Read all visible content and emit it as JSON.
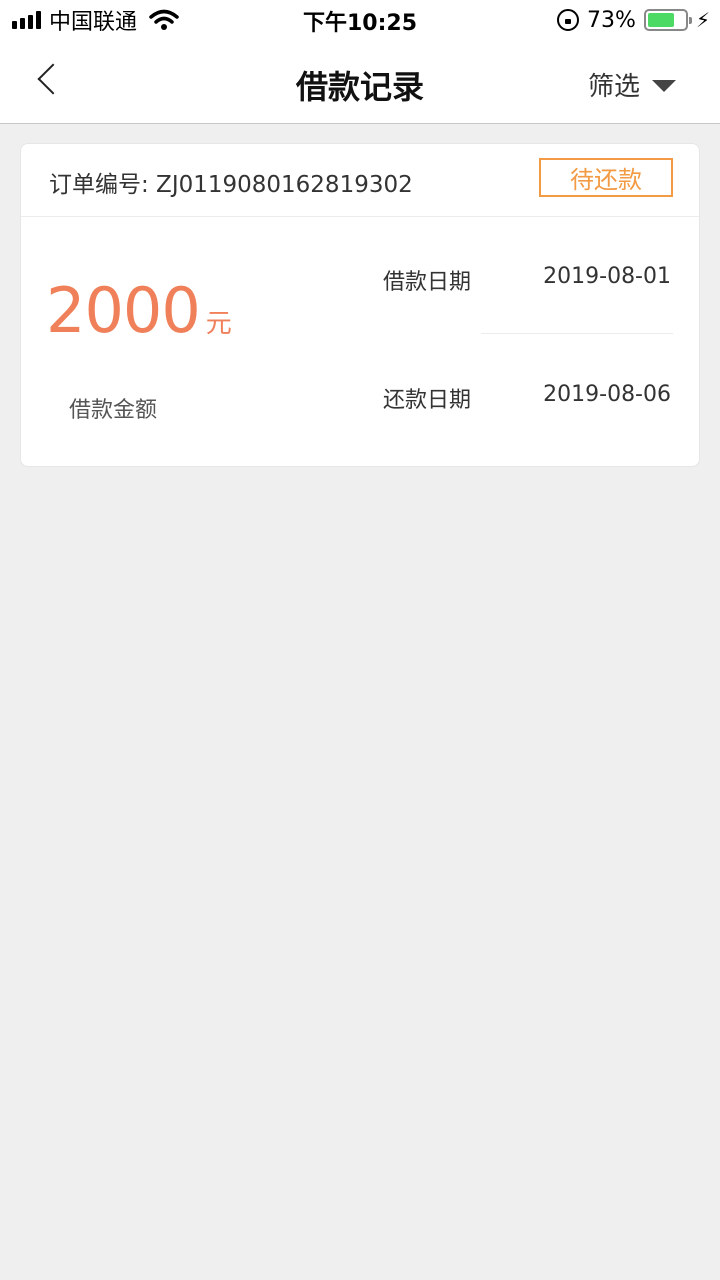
{
  "status_bar": {
    "carrier": "中国联通",
    "time": "下午10:25",
    "battery_percent": "73%",
    "battery_level": 0.73
  },
  "nav": {
    "title": "借款记录",
    "filter_label": "筛选"
  },
  "record": {
    "order_label": "订单编号: ZJ0119080162819302",
    "status": "待还款",
    "amount": "2000",
    "amount_unit": "元",
    "amount_label": "借款金额",
    "borrow_date_label": "借款日期",
    "borrow_date": "2019-08-01",
    "repay_date_label": "还款日期",
    "repay_date": "2019-08-06"
  },
  "colors": {
    "accent_orange": "#f29a44",
    "amount_color": "#f0805a",
    "battery_green": "#4cd964"
  }
}
